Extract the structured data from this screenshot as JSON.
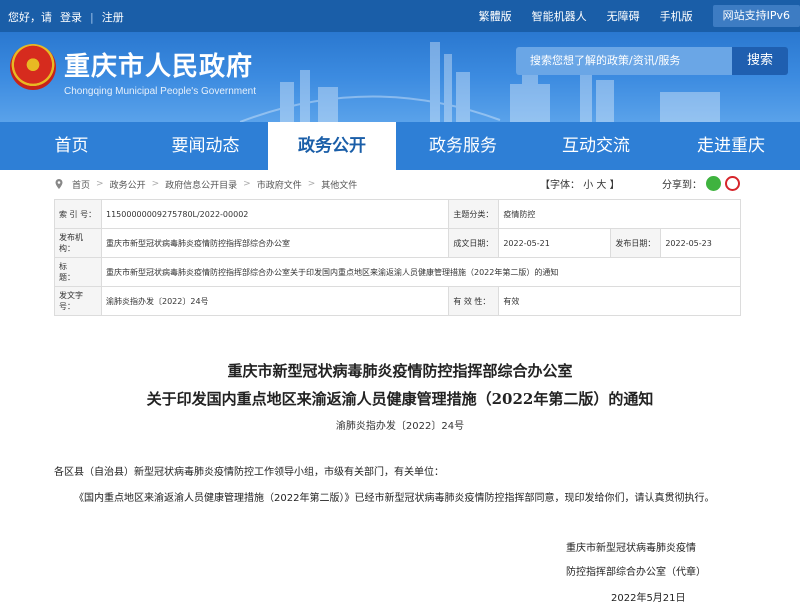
{
  "topbar": {
    "greeting": "您好，请",
    "login": "登录",
    "register": "注册",
    "links": [
      "繁體版",
      "智能机器人",
      "无障碍",
      "手机版",
      "网站支持IPv6"
    ]
  },
  "header": {
    "title": "重庆市人民政府",
    "subtitle": "Chongqing Municipal People's Government",
    "search_placeholder": "搜索您想了解的政策/资讯/服务",
    "search_button": "搜索"
  },
  "nav": [
    "首页",
    "要闻动态",
    "政务公开",
    "政务服务",
    "互动交流",
    "走进重庆"
  ],
  "nav_active": 2,
  "breadcrumb": [
    "首页",
    "政务公开",
    "政府信息公开目录",
    "市政府文件",
    "其他文件"
  ],
  "font_size": {
    "label": "【字体：",
    "small": "小",
    "large": "大",
    "end": "】"
  },
  "share_label": "分享到：",
  "info": {
    "index_label": "索 引 号：",
    "index_value": "11500000009275780L/2022-00002",
    "topic_label": "主题分类：",
    "topic_value": "疫情防控",
    "issuer_label": "发布机构：",
    "issuer_value": "重庆市新型冠状病毒肺炎疫情防控指挥部综合办公室",
    "written_label": "成文日期：",
    "written_value": "2022-05-21",
    "publish_label": "发布日期：",
    "publish_value": "2022-05-23",
    "title_label": "标　　题：",
    "title_value": "重庆市新型冠状病毒肺炎疫情防控指挥部综合办公室关于印发国内重点地区来渝返渝人员健康管理措施（2022年第二版）的通知",
    "docno_label": "发文字号：",
    "docno_value": "渝肺炎指办发〔2022〕24号",
    "valid_label": "有 效 性：",
    "valid_value": "有效"
  },
  "article": {
    "title_line1": "重庆市新型冠状病毒肺炎疫情防控指挥部综合办公室",
    "title_line2": "关于印发国内重点地区来渝返渝人员健康管理措施（2022年第二版）的通知",
    "doc_number": "渝肺炎指办发〔2022〕24号",
    "salutation": "各区县（自治县）新型冠状病毒肺炎疫情防控工作领导小组，市级有关部门，有关单位：",
    "body": "《国内重点地区来渝返渝人员健康管理措施（2022年第二版）》已经市新型冠状病毒肺炎疫情防控指挥部同意，现印发给你们，请认真贯彻执行。",
    "sign_line1": "重庆市新型冠状病毒肺炎疫情",
    "sign_line2": "防控指挥部综合办公室（代章）",
    "date": "2022年5月21日"
  },
  "colors": {
    "primary": "#1a5ea8",
    "nav": "#2e7fd6",
    "emblem_red": "#d62b1e"
  }
}
